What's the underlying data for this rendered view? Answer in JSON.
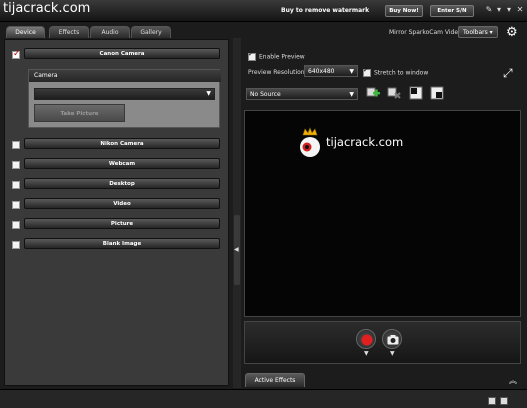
{
  "header": {
    "brand": "tijacrack.com",
    "watermark_text": "Buy to remove watermark",
    "buy_now": "Buy Now!",
    "enter_sn": "Enter S/N"
  },
  "tabs": [
    "Device",
    "Effects",
    "Audio",
    "Gallery"
  ],
  "devices": [
    {
      "label": "Canon Camera",
      "checked": true
    },
    {
      "label": "Nikon Camera",
      "checked": false
    },
    {
      "label": "Webcam",
      "checked": false
    },
    {
      "label": "Desktop",
      "checked": false
    },
    {
      "label": "Video",
      "checked": false
    },
    {
      "label": "Picture",
      "checked": false
    },
    {
      "label": "Blank Image",
      "checked": false
    }
  ],
  "camera_group": {
    "title": "Camera",
    "take_picture": "Take Picture"
  },
  "right_header": {
    "mirror_label": "Mirror SparkoCam Video",
    "toolbars": "Toolbars"
  },
  "preview_controls": {
    "enable_preview": "Enable Preview",
    "resolution_label": "Preview Resolution:",
    "resolution_value": "640x480",
    "stretch": "Stretch to window",
    "source_value": "No Source"
  },
  "preview": {
    "watermark_text": "tijacrack.com"
  },
  "effects": {
    "tab_label": "Active Effects"
  },
  "icons": {
    "gear": "gear-icon",
    "fullscreen": "fullscreen-icon",
    "record": "record-icon",
    "camera": "camera-icon",
    "add_source": "add-source-icon",
    "remove_source": "remove-source-icon"
  },
  "colors": {
    "record_red": "#e02020",
    "add_green": "#3cba3c",
    "background": "#1c1c1c"
  }
}
